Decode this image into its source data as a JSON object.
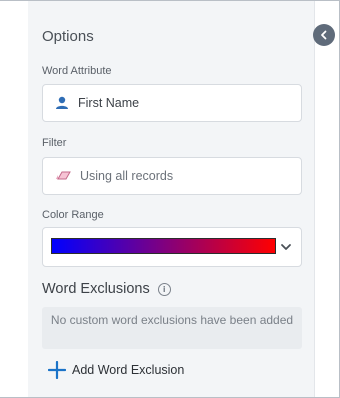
{
  "options": {
    "title": "Options",
    "word_attribute": {
      "label": "Word Attribute",
      "value": "First Name",
      "icon": "person-icon"
    },
    "filter": {
      "label": "Filter",
      "value": "Using all records",
      "icon": "eraser-icon"
    },
    "color_range": {
      "label": "Color Range",
      "gradient_start": "#0000ff",
      "gradient_end": "#ff0000"
    },
    "word_exclusions": {
      "title": "Word Exclusions",
      "empty_message": "No custom word exclusions have been added",
      "add_label": "Add Word Exclusion"
    }
  },
  "colors": {
    "accent": "#1a73c8",
    "collapse_button": "#5f6b7a",
    "panel_bg": "#f3f5f7"
  }
}
